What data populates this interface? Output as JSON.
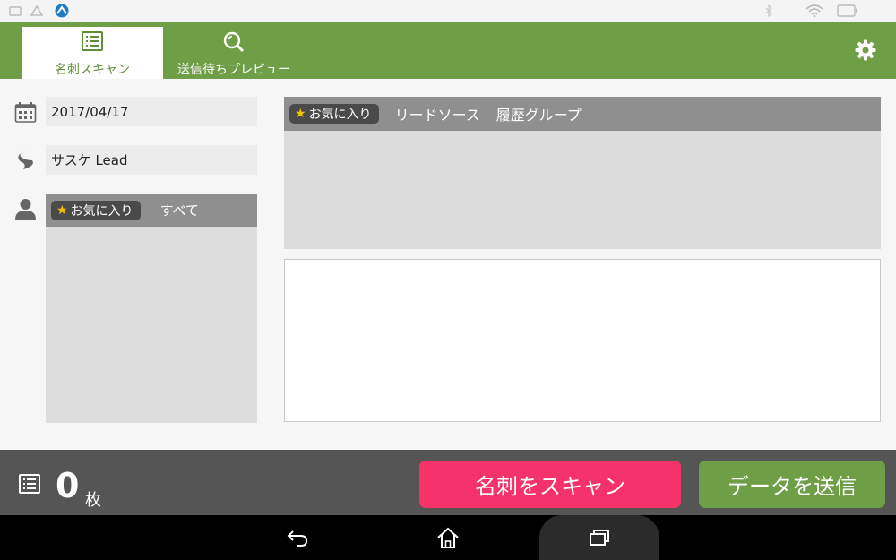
{
  "statusbar": {
    "icons": [
      "screenshot-icon",
      "alert-icon",
      "app-icon",
      "wifi-icon",
      "battery-icon"
    ]
  },
  "header": {
    "tabs": [
      {
        "label": "名刺スキャン",
        "icon": "card-list-icon",
        "active": true
      },
      {
        "label": "送信待ちプレビュー",
        "icon": "search-icon",
        "active": false
      }
    ],
    "settings_icon": "gear-icon",
    "accent": "#6e9e46"
  },
  "left": {
    "date": "2017/04/17",
    "source": "サスケ Lead",
    "filter": {
      "favorite": "お気に入り",
      "all": "すべて"
    }
  },
  "right": {
    "favorite": "お気に入り",
    "lead_source": "リードソース",
    "history_group": "履歴グループ"
  },
  "bottom": {
    "count": "0",
    "unit": "枚",
    "scan_button": "名刺をスキャン",
    "send_button": "データを送信",
    "scan_color": "#f5336a"
  },
  "navbar": {
    "icons": [
      "back-icon",
      "home-icon",
      "recent-apps-icon"
    ]
  }
}
